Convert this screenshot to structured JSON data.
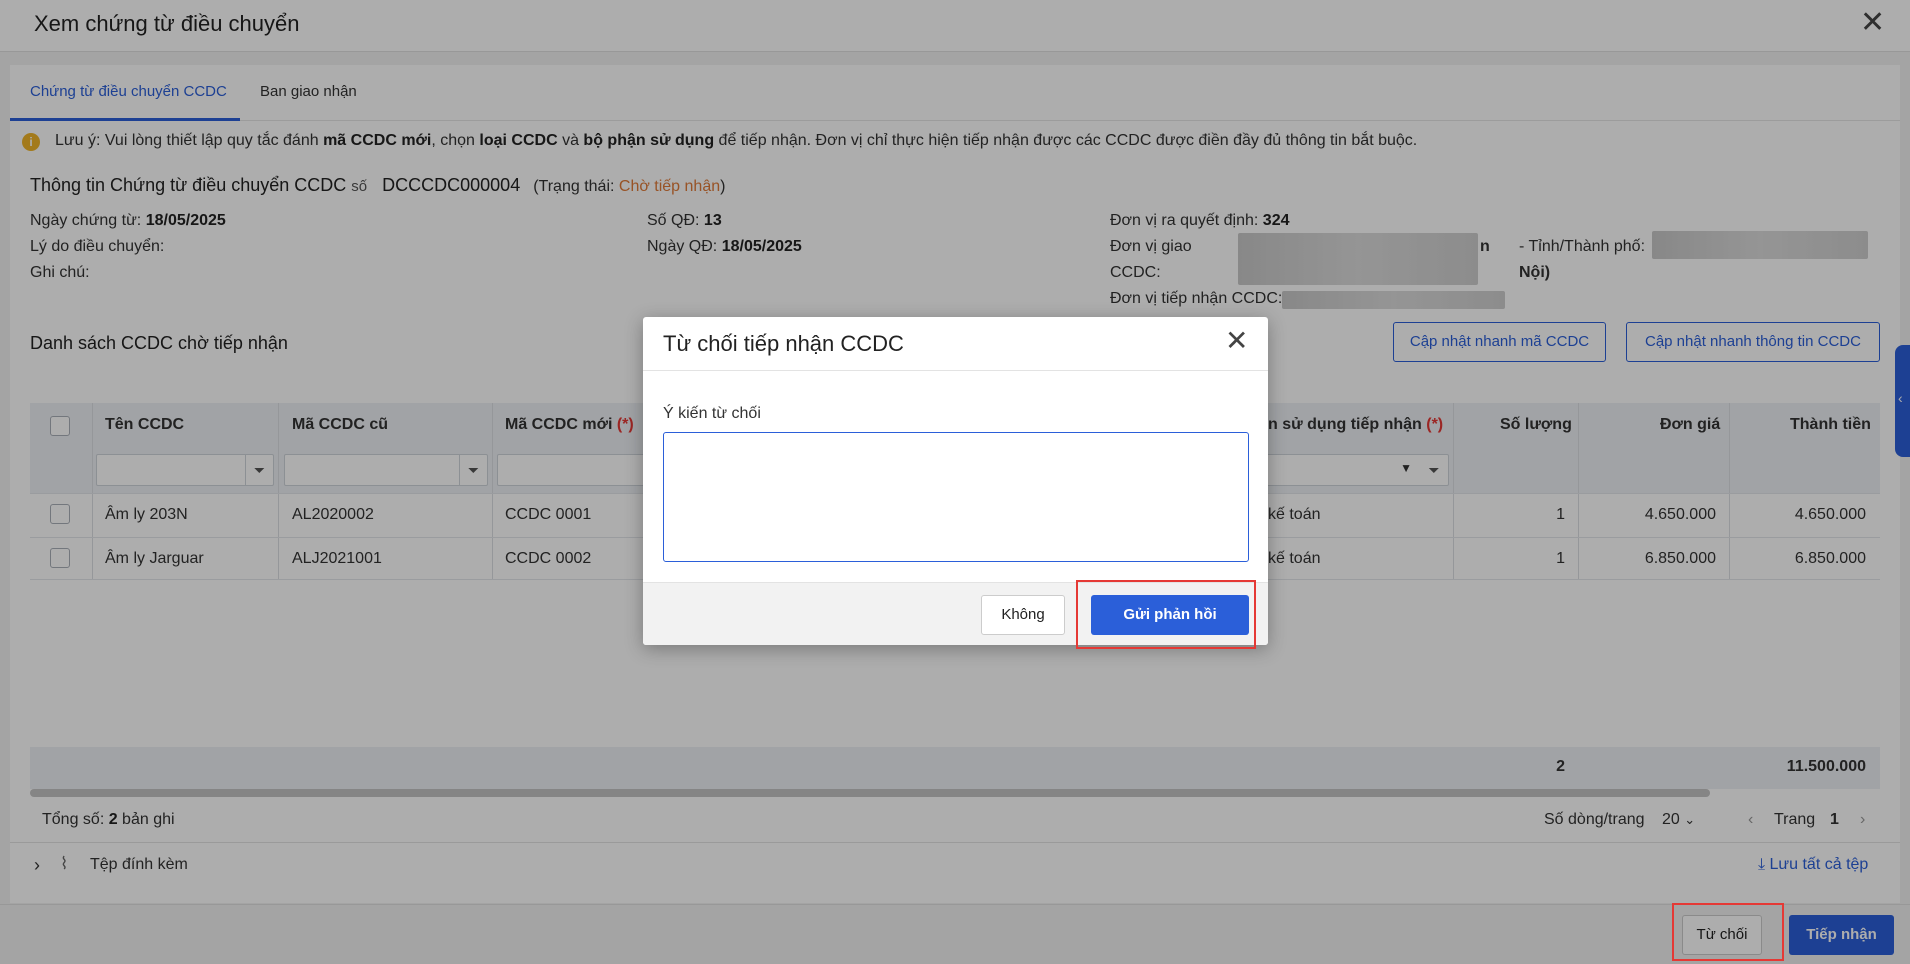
{
  "window": {
    "title": "Xem chứng từ điều chuyển"
  },
  "tabs": [
    {
      "label": "Chứng từ điều chuyển CCDC"
    },
    {
      "label": "Ban giao nhận"
    }
  ],
  "notice": {
    "p1": "Lưu ý: Vui lòng thiết lập quy tắc đánh ",
    "b1": "mã CCDC mới",
    "p2": ", chọn ",
    "b2": "loại CCDC",
    "p3": " và ",
    "b3": "bộ phận sử dụng",
    "p4": " để tiếp nhận. Đơn vị chỉ thực hiện tiếp nhận được các CCDC được điền đầy đủ thông tin bắt buộc."
  },
  "info": {
    "heading": "Thông tin Chứng từ điều chuyển CCDC",
    "so_label": "số",
    "doc_no": "DCCCDC000004",
    "status_prefix": "(Trạng thái: ",
    "status": "Chờ tiếp nhận",
    "status_suffix": ")",
    "date_label": "Ngày chứng từ:",
    "date": "18/05/2025",
    "reason_label": "Lý do điều chuyển:",
    "note_label": "Ghi chú:",
    "qd_label": "Số QĐ:",
    "qd": "13",
    "qd_date_label": "Ngày QĐ:",
    "qd_date": "18/05/2025",
    "decider_label": "Đơn vị ra quyết định:",
    "decider": "324",
    "giver_label1": "Đơn vị giao",
    "giver_label2": "CCDC:",
    "giver_tail": "n",
    "province_label": "- Tỉnh/Thành phố:",
    "province_tail": "Nội)",
    "receiver_label": "Đơn vị tiếp nhận CCDC:"
  },
  "list": {
    "title": "Danh sách CCDC chờ tiếp nhận",
    "btn_update_code": "Cập nhật nhanh mã CCDC",
    "btn_update_info": "Cập nhật nhanh thông tin CCDC"
  },
  "table": {
    "headers": [
      "Tên CCDC",
      "Mã CCDC cũ",
      "Mã CCDC mới",
      "n sử dụng tiếp nhận",
      "Số lượng",
      "Đơn giá",
      "Thành tiền"
    ],
    "required_mark": "(*)",
    "rows": [
      {
        "name": "Âm ly 203N",
        "old": "AL2020002",
        "new": "CCDC 0001",
        "dept": "kế toán",
        "qty": "1",
        "price": "4.650.000",
        "total": "4.650.000"
      },
      {
        "name": "Âm ly Jarguar",
        "old": "ALJ2021001",
        "new": "CCDC 0002",
        "dept": "kế toán",
        "qty": "1",
        "price": "6.850.000",
        "total": "6.850.000"
      }
    ],
    "footer_qty": "2",
    "footer_total": "11.500.000"
  },
  "pager": {
    "total_prefix": "Tổng số: ",
    "total_count": "2",
    "total_suffix": " bản ghi",
    "rows_label": "Số dòng/trang",
    "rows_value": "20",
    "page_label": "Trang",
    "page": "1"
  },
  "attach": {
    "label": "Tệp đính kèm",
    "save_all": "Lưu tất cả tệp"
  },
  "actions": {
    "reject": "Từ chối",
    "accept": "Tiếp nhận"
  },
  "modal": {
    "title": "Từ chối tiếp nhận CCDC",
    "field_label": "Ý kiến từ chối",
    "textarea_value": "",
    "cancel": "Không",
    "submit": "Gửi phản hồi"
  },
  "colors": {
    "accent": "#2b5fd9",
    "status": "#e07b39",
    "required": "#e53935"
  }
}
